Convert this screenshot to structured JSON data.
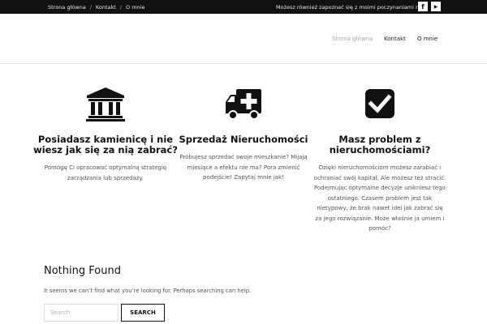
{
  "topbar": {
    "links": [
      "Strona główna",
      "Kontakt",
      "O mnie"
    ],
    "separator": "/",
    "social_text": "Możesz również zapoznać się z moimi poczynaniami na:",
    "social": [
      {
        "icon": "facebook-icon",
        "glyph": "f"
      },
      {
        "icon": "youtube-icon",
        "glyph": "▶"
      }
    ]
  },
  "nav": {
    "items": [
      "Strona główna",
      "Kontakt",
      "O mnie"
    ],
    "active_index": 0
  },
  "features": [
    {
      "icon": "bank-icon",
      "title": "Posiadasz kamienicę i nie wiesz jak się za nią zabrać?",
      "text": "Pomogę Ci opracować optymalną strategię zarządzania lub sprzedaży."
    },
    {
      "icon": "ambulance-icon",
      "title": "Sprzedaż Nieruchomości",
      "text": "Próbujesz sprzedać swoje mieszkanie? Mijają miesiące a efektu nie ma? Pora zmienić podejście! Zapytaj mnie jak!"
    },
    {
      "icon": "checkbox-icon",
      "title": "Masz problem z nieruchomościami?",
      "text": "Dzięki nieruchomościom możesz zarabiać i ochraniać swój kapitał. Ale możesz też stracić. Podejmując optymalne decyzje unikniesz tego ostatniego. Czasem problem jest tak nietypowy, że brak nawet idei jak zabrać się za jego rozwiązanie. Może właśnie ja umiem i pomóc?"
    }
  ],
  "not_found": {
    "title": "Nothing Found",
    "text": "It seems we can’t find what you’re looking for. Perhaps searching can help.",
    "search_placeholder": "Search",
    "search_value": "",
    "search_button": "SEARCH"
  },
  "colors": {
    "topbar_bg": "#111111",
    "nav_active": "#aaaaaa",
    "text": "#333333"
  }
}
